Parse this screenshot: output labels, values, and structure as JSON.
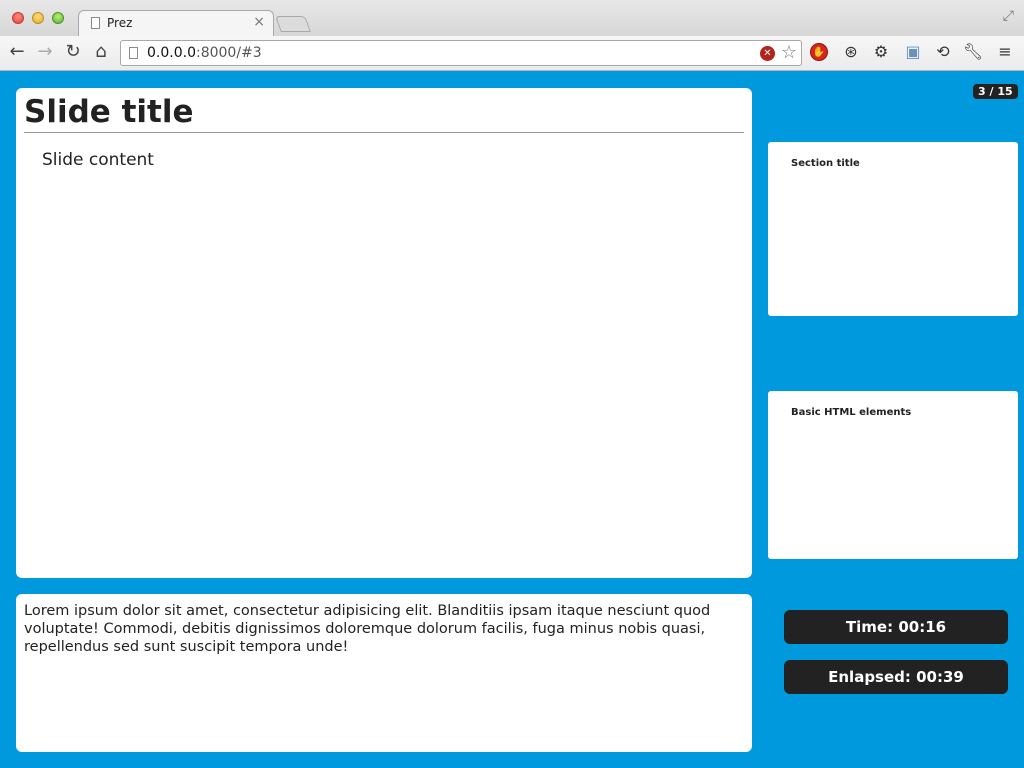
{
  "browser": {
    "tab": {
      "title": "Prez",
      "close_glyph": "×"
    },
    "url": {
      "host": "0.0.0.0",
      "rest": ":8000/#3"
    },
    "colors": {
      "page_background": "#0099dd"
    },
    "icons": {
      "back": "back-arrow-icon",
      "forward": "forward-arrow-icon",
      "reload": "reload-icon",
      "home": "home-icon",
      "bookmark": "star-icon",
      "menu": "hamburger-menu-icon"
    }
  },
  "presenter": {
    "counter": "3 / 15",
    "slide": {
      "title": "Slide title",
      "content": "Slide content"
    },
    "notes": "Lorem ipsum dolor sit amet, consectetur adipisicing elit. Blanditiis ipsam itaque nesciunt quod voluptate! Commodi, debitis dignissimos doloremque dolorum facilis, fuga minus nobis quasi, repellendus sed sunt suscipit tempora unde!",
    "previews": [
      {
        "label": "Section title"
      },
      {
        "label": "Basic HTML elements"
      }
    ],
    "time_label": "Time: 00:16",
    "elapsed_label": "Enlapsed: 00:39"
  }
}
